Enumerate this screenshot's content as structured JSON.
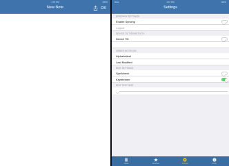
{
  "left": {
    "status": {
      "time": "4:07 PM",
      "battery": "100%"
    },
    "title": "New Note",
    "ok_label": "OK"
  },
  "right": {
    "status": {
      "carrier": "iPad",
      "time": "4:07 PM",
      "battery": "100%"
    },
    "title": "Settings",
    "sections": [
      {
        "header": "DROPBOX SETTINGS",
        "rows": [
          {
            "label": "Enable Syncing",
            "toggle": false
          },
          {
            "label": "Logout",
            "muted": true
          }
        ]
      },
      {
        "header": "DEVICE TILT SENSITIVITY",
        "rows": [
          {
            "label": "Device Tilt",
            "toggle": false
          }
        ]
      },
      {
        "header": "ORDER NOTES BY",
        "rows": [
          {
            "label": "Alphabetical"
          },
          {
            "label": "Last Modified"
          }
        ]
      },
      {
        "header": "EDIT SETTINGS",
        "rows": [
          {
            "label": "Spellcheck",
            "toggle": false
          },
          {
            "label": "Keytrimmer",
            "toggle": true
          }
        ]
      },
      {
        "header": "EDIT TEXT SIZE",
        "slider_value": 0
      }
    ],
    "tabs": [
      {
        "label": "Notes",
        "icon": "notes-icon"
      },
      {
        "label": "Favorites",
        "icon": "star-icon"
      },
      {
        "label": "Settings",
        "icon": "settings-icon",
        "active": true
      },
      {
        "label": "About",
        "icon": "info-icon"
      }
    ]
  },
  "colors": {
    "nav": "#3e74ab",
    "tabbar": "#3a6da2",
    "background": "#efeff4",
    "toggle_on": "#4cd964",
    "active_tab": "#f2c200"
  }
}
